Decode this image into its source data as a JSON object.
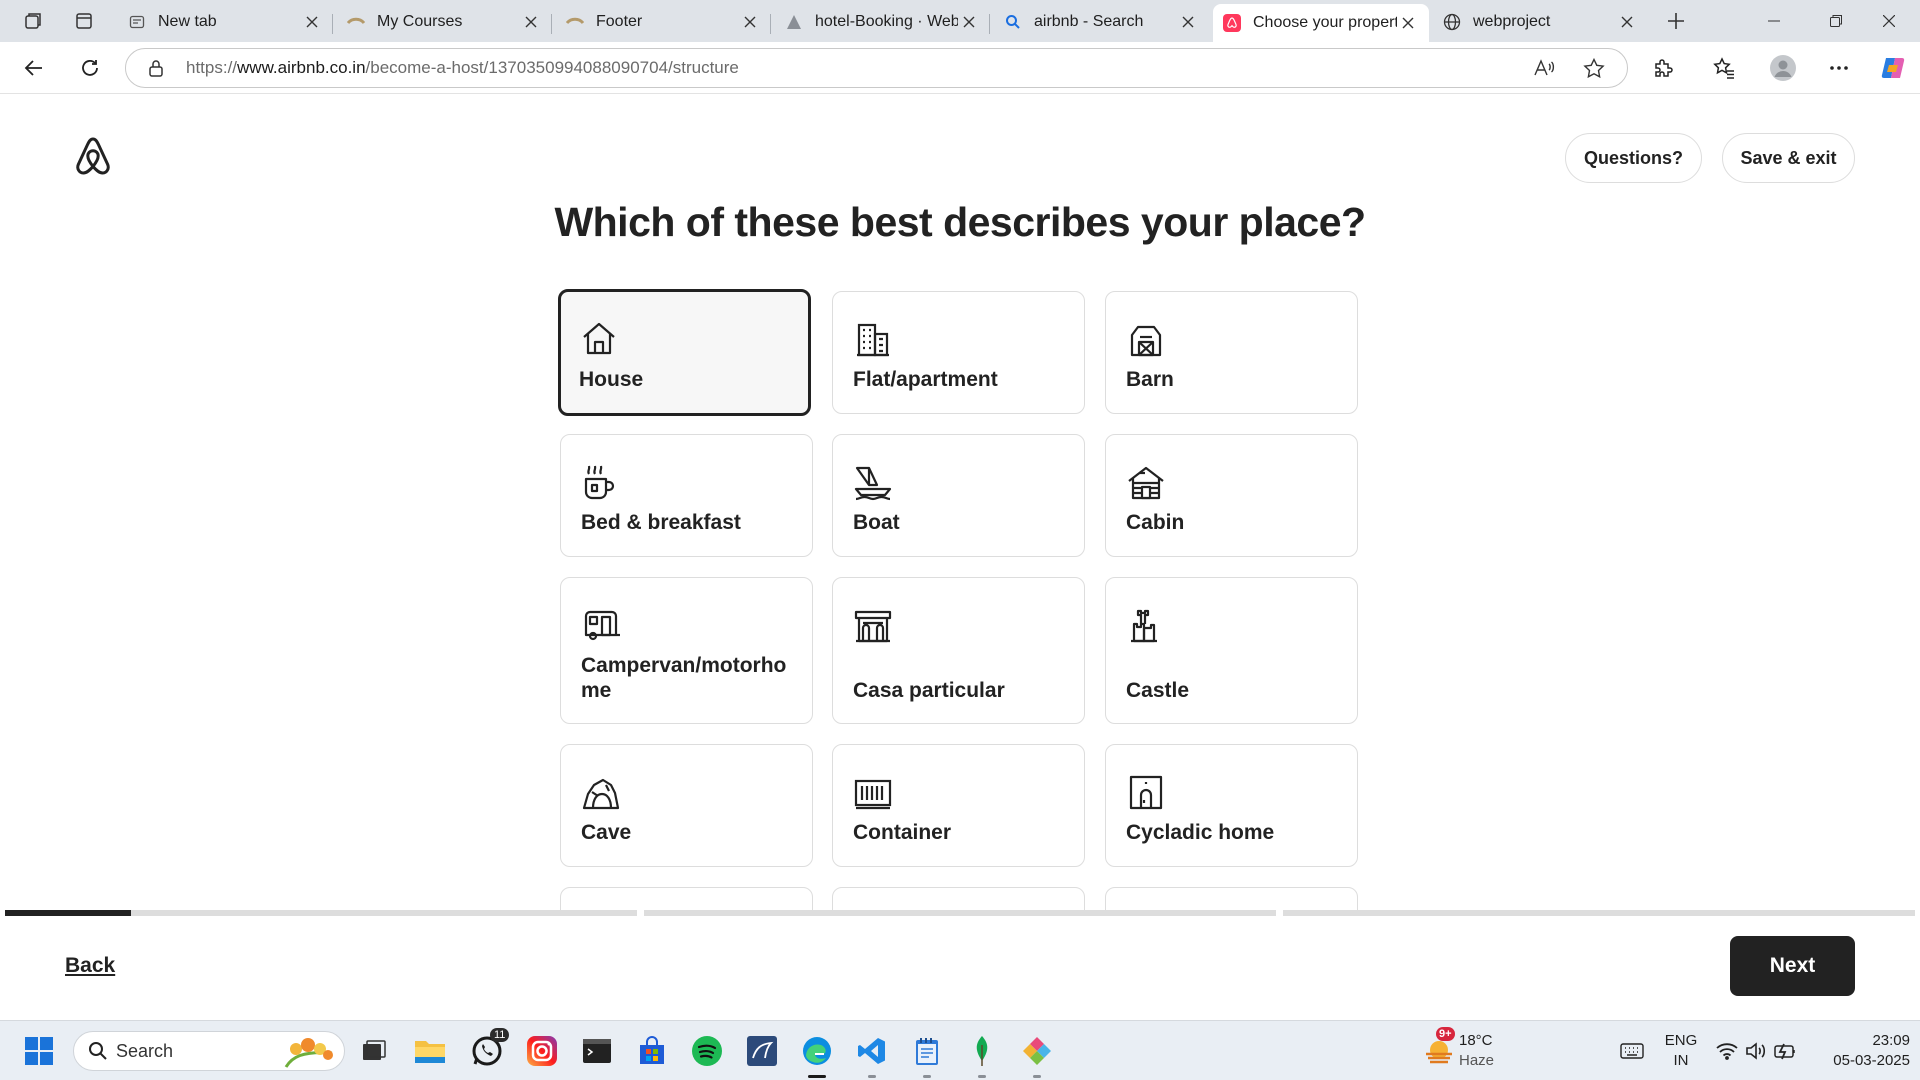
{
  "browser": {
    "tabs": [
      {
        "title": "New tab",
        "icon": "newtab-icon"
      },
      {
        "title": "My Courses",
        "icon": "courses-icon"
      },
      {
        "title": "Footer",
        "icon": "footer-icon"
      },
      {
        "title": "hotel-Booking · Web",
        "icon": "hotel-icon"
      },
      {
        "title": "airbnb - Search",
        "icon": "search-icon"
      },
      {
        "title": "Choose your property",
        "icon": "airbnb-icon",
        "active": true
      },
      {
        "title": "webproject",
        "icon": "globe-icon"
      }
    ],
    "url_prefix": "https://",
    "url_host": "www.airbnb.co.in",
    "url_path": "/become-a-host/1370350994088090704/structure"
  },
  "page": {
    "questions_label": "Questions?",
    "save_exit_label": "Save & exit",
    "heading": "Which of these best describes your place?",
    "options": [
      {
        "label": "House",
        "icon": "house-icon",
        "selected": true
      },
      {
        "label": "Flat/apartment",
        "icon": "apartment-icon"
      },
      {
        "label": "Barn",
        "icon": "barn-icon"
      },
      {
        "label": "Bed & breakfast",
        "icon": "coffee-cup-icon"
      },
      {
        "label": "Boat",
        "icon": "boat-icon"
      },
      {
        "label": "Cabin",
        "icon": "cabin-icon"
      },
      {
        "label": "Campervan/motorhome",
        "icon": "campervan-icon"
      },
      {
        "label": "Casa particular",
        "icon": "casa-icon"
      },
      {
        "label": "Castle",
        "icon": "castle-icon"
      },
      {
        "label": "Cave",
        "icon": "cave-icon"
      },
      {
        "label": "Container",
        "icon": "container-icon"
      },
      {
        "label": "Cycladic home",
        "icon": "cycladic-icon"
      }
    ],
    "progress_fraction_first_segment": 0.2,
    "back_label": "Back",
    "next_label": "Next"
  },
  "taskbar": {
    "search_placeholder": "Search",
    "whatsapp_badge": "11",
    "weather_badge": "9+",
    "temperature": "18°C",
    "weather": "Haze",
    "lang_1": "ENG",
    "lang_2": "IN",
    "time": "23:09",
    "date": "05-03-2025"
  }
}
